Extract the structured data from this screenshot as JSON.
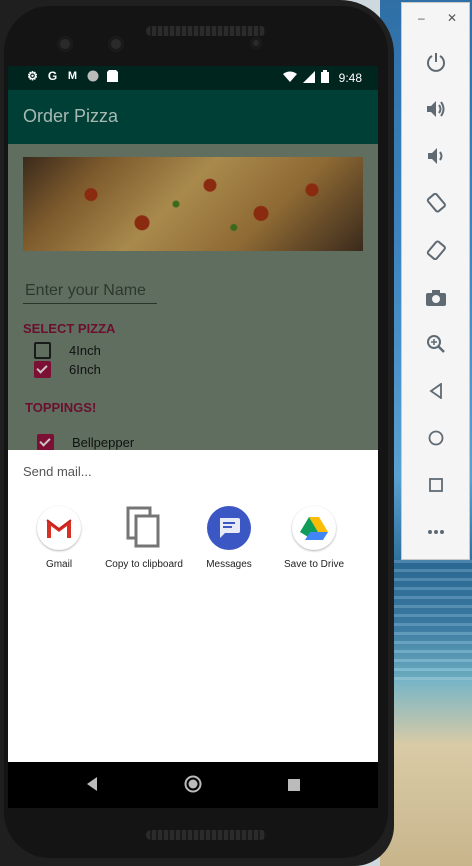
{
  "status_bar": {
    "time": "9:48",
    "left_icons": [
      "settings-icon",
      "google-icon",
      "gmail-icon",
      "circle-icon",
      "sd-card-icon"
    ],
    "right_icons": [
      "wifi-icon",
      "signal-icon",
      "battery-icon"
    ]
  },
  "app": {
    "title": "Order Pizza",
    "name_placeholder": "Enter your Name",
    "select_pizza_label": "SELECT PIZZA",
    "pizza_options": [
      {
        "label": "4Inch",
        "checked": false
      },
      {
        "label": "6Inch",
        "checked": true
      }
    ],
    "toppings_label": "TOPPINGS!",
    "toppings": [
      {
        "label": "Bellpepper",
        "checked": true
      }
    ]
  },
  "share_sheet": {
    "title": "Send mail...",
    "targets": [
      {
        "label": "Gmail",
        "icon": "gmail-icon"
      },
      {
        "label": "Copy to clipboard",
        "icon": "copy-icon"
      },
      {
        "label": "Messages",
        "icon": "messages-icon"
      },
      {
        "label": "Save to Drive",
        "icon": "drive-icon"
      }
    ]
  },
  "nav_bar": {
    "buttons": [
      "back-icon",
      "home-icon",
      "recents-icon"
    ]
  },
  "emulator_panel": {
    "window_controls": [
      "minimize-icon",
      "close-icon"
    ],
    "buttons": [
      "power-icon",
      "volume-up-icon",
      "volume-down-icon",
      "rotate-left-icon",
      "rotate-right-icon",
      "camera-icon",
      "zoom-icon",
      "back-icon",
      "home-icon",
      "overview-icon",
      "more-icon"
    ]
  },
  "colors": {
    "toolbar": "#003f35",
    "status_bar": "#00241e",
    "accent": "#7b1034",
    "scrim_content": "#5f6e5f"
  }
}
